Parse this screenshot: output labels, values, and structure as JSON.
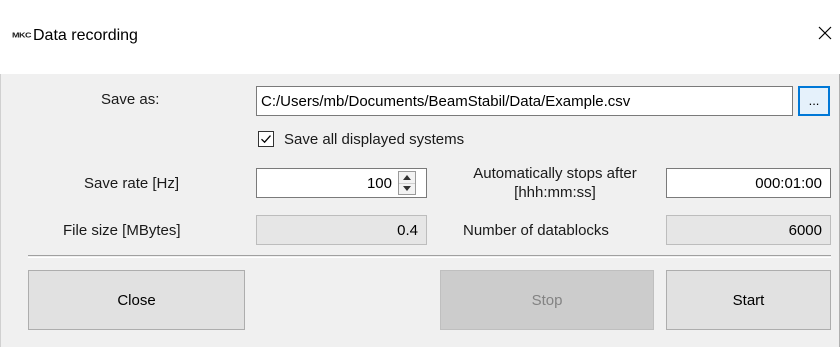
{
  "window": {
    "logo_text": "MKC",
    "title": "Data recording"
  },
  "form": {
    "save_as_label": "Save as:",
    "save_as_value": "C:/Users/mb/Documents/BeamStabil/Data/Example.csv",
    "browse_label": "...",
    "save_all_label": "Save all displayed systems",
    "save_all_checked": true,
    "save_rate_label": "Save rate [Hz]",
    "save_rate_value": "100",
    "auto_stop_label_line1": "Automatically stops after",
    "auto_stop_label_line2": "[hhh:mm:ss]",
    "auto_stop_value": "000:01:00",
    "file_size_label": "File size [MBytes]",
    "file_size_value": "0.4",
    "datablocks_label": "Number of datablocks",
    "datablocks_value": "6000"
  },
  "buttons": {
    "close": "Close",
    "stop": "Stop",
    "start": "Start"
  },
  "colors": {
    "accent": "#0078d7",
    "dialog_bg": "#f0f0f0",
    "readonly_bg": "#e6e6e6"
  }
}
